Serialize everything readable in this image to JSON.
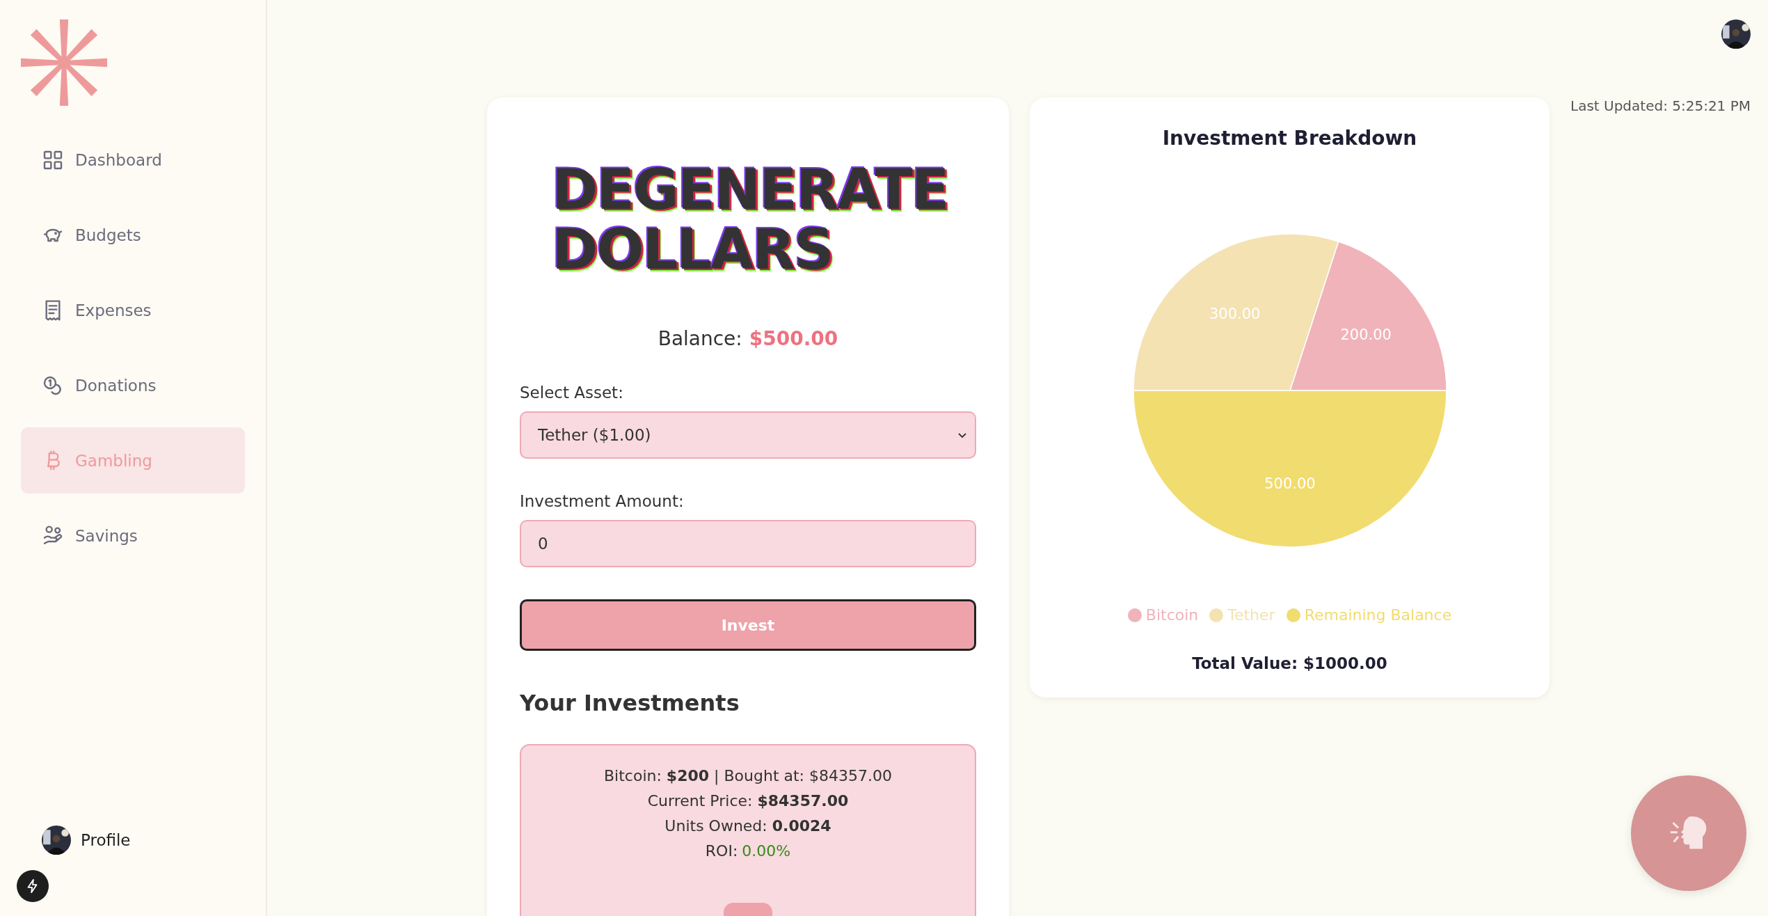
{
  "sidebar": {
    "items": [
      {
        "label": "Dashboard",
        "selected": false
      },
      {
        "label": "Budgets",
        "selected": false
      },
      {
        "label": "Expenses",
        "selected": false
      },
      {
        "label": "Donations",
        "selected": false
      },
      {
        "label": "Gambling",
        "selected": true
      },
      {
        "label": "Savings",
        "selected": false
      }
    ],
    "profile": {
      "label": "Profile"
    }
  },
  "header": {
    "last_updated": "Last Updated: 5:25:21 PM"
  },
  "game": {
    "title_lines": [
      "DEGENERATE",
      "DOLLARS"
    ],
    "balance_label": "Balance:",
    "balance_value": "$500.00",
    "asset_label": "Select Asset:",
    "asset_value": "Tether ($1.00)",
    "amount_label": "Investment Amount:",
    "amount_value": "0",
    "invest_button": "Invest",
    "investments_heading": "Your Investments",
    "investments": [
      {
        "lines": [
          "Bitcoin: **$200** | Bought at: $84357.00",
          "Current Price: **$84357.00**",
          "Units Owned: **0.0024**"
        ],
        "roi_label": "ROI:",
        "roi_value": "0.00%"
      }
    ]
  },
  "breakdown": {
    "title": "Investment Breakdown",
    "chart_data": {
      "type": "pie",
      "categories": [
        "Bitcoin",
        "Tether",
        "Remaining Balance"
      ],
      "values": [
        200,
        300,
        500
      ],
      "value_labels": [
        "200.00",
        "300.00",
        "500.00"
      ]
    },
    "legend": [
      {
        "color": "#f0b3b9"
      },
      {
        "color": "#f4e2b2"
      },
      {
        "color": "#f1dc70"
      }
    ],
    "total": "Total Value: $1000.00"
  }
}
